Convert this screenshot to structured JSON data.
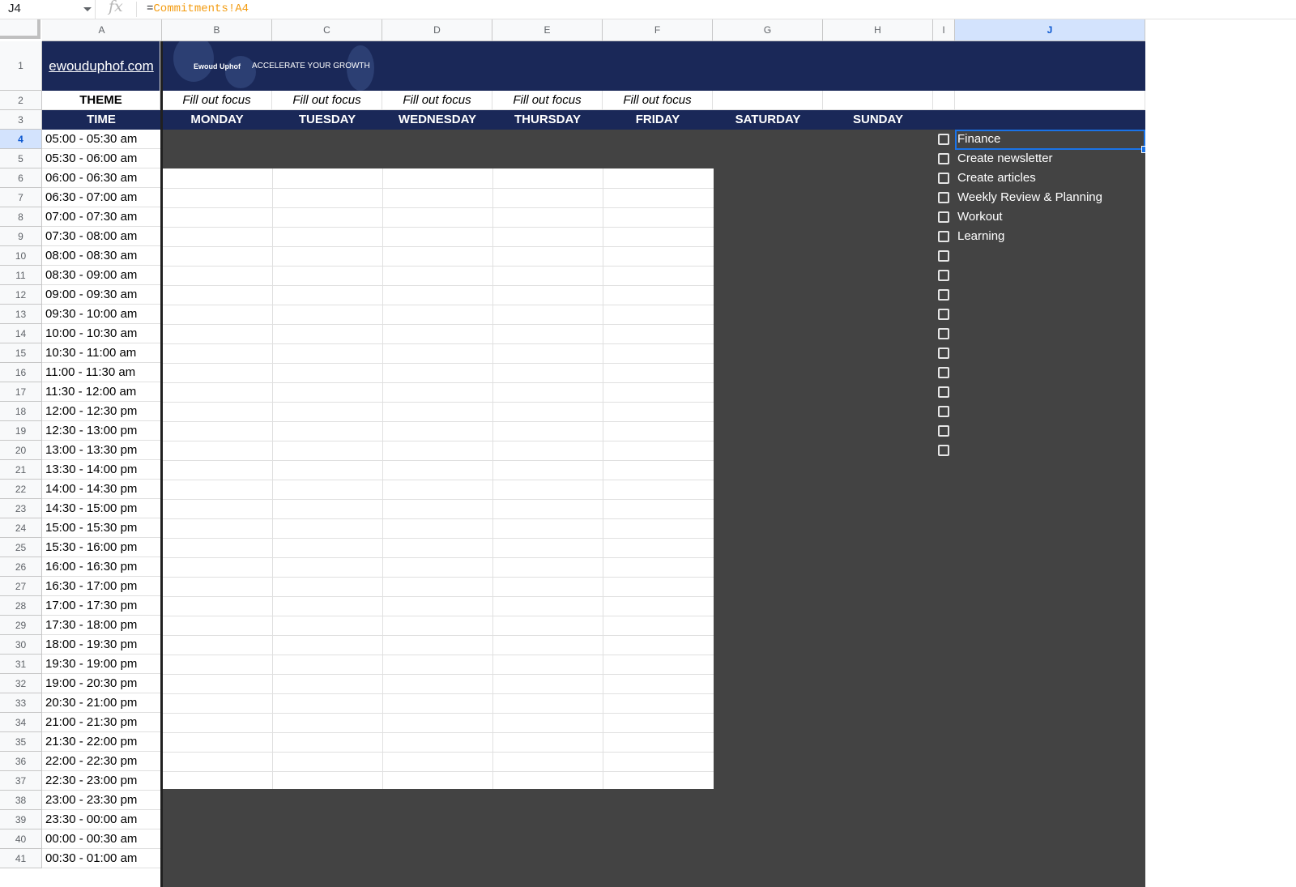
{
  "formula_bar": {
    "cell_ref": "J4",
    "fx": "fx",
    "formula_prefix": "=",
    "formula_ref": "Commitments!A4"
  },
  "columns": [
    "A",
    "B",
    "C",
    "D",
    "E",
    "F",
    "G",
    "H",
    "I",
    "J"
  ],
  "rows": [
    "1",
    "2",
    "3",
    "4",
    "5",
    "6",
    "7",
    "8",
    "9",
    "10",
    "11",
    "12",
    "13",
    "14",
    "15",
    "16",
    "17",
    "18",
    "19",
    "20",
    "21",
    "22",
    "23",
    "24",
    "25",
    "26",
    "27",
    "28",
    "29",
    "30",
    "31",
    "32",
    "33",
    "34",
    "35",
    "36",
    "37",
    "38",
    "39",
    "40",
    "41"
  ],
  "banner": {
    "link": "ewouduphof.com",
    "brand": "Ewoud Uphof",
    "tagline": "ACCELERATE YOUR GROWTH"
  },
  "theme_label": "THEME",
  "focus": [
    "Fill out focus",
    "Fill out focus",
    "Fill out focus",
    "Fill out focus",
    "Fill out focus"
  ],
  "time_label": "TIME",
  "days": [
    "MONDAY",
    "TUESDAY",
    "WEDNESDAY",
    "THURSDAY",
    "FRIDAY",
    "SATURDAY",
    "SUNDAY"
  ],
  "times": [
    "05:00 - 05:30 am",
    "05:30 - 06:00 am",
    "06:00 - 06:30 am",
    "06:30 - 07:00 am",
    "07:00 - 07:30 am",
    "07:30 - 08:00 am",
    "08:00 - 08:30 am",
    "08:30 - 09:00 am",
    "09:00 - 09:30 am",
    "09:30 - 10:00 am",
    "10:00 - 10:30 am",
    "10:30 - 11:00 am",
    "11:00 - 11:30 am",
    "11:30 - 12:00 am",
    "12:00  - 12:30 pm",
    "12:30 - 13:00 pm",
    "13:00 - 13:30 pm",
    "13:30 - 14:00 pm",
    "14:00 - 14:30 pm",
    "14:30 - 15:00 pm",
    "15:00 - 15:30 pm",
    "15:30 - 16:00 pm",
    "16:00 - 16:30 pm",
    "16:30 - 17:00 pm",
    "17:00 - 17:30 pm",
    "17:30 - 18:00 pm",
    "18:00 - 19:30 pm",
    "19:30 - 19:00 pm",
    "19:00 - 20:30 pm",
    "20:30 - 21:00 pm",
    "21:00 - 21:30 pm",
    "21:30 - 22:00 pm",
    "22:00 - 22:30 pm",
    "22:30 - 23:00 pm",
    "23:00 - 23:30 pm",
    "23:30 - 00:00 am",
    "00:00 - 00:30 am",
    "00:30 - 01:00 am"
  ],
  "commitments": [
    "Finance",
    "Create newsletter",
    "Create articles",
    "Weekly Review & Planning",
    "Workout",
    "Learning",
    "",
    "",
    "",
    "",
    "",
    "",
    "",
    "",
    "",
    "",
    ""
  ],
  "colors": {
    "navy": "#1a2858",
    "dark": "#434343",
    "selection": "#1a73e8",
    "formula_ref": "#f39c12"
  }
}
